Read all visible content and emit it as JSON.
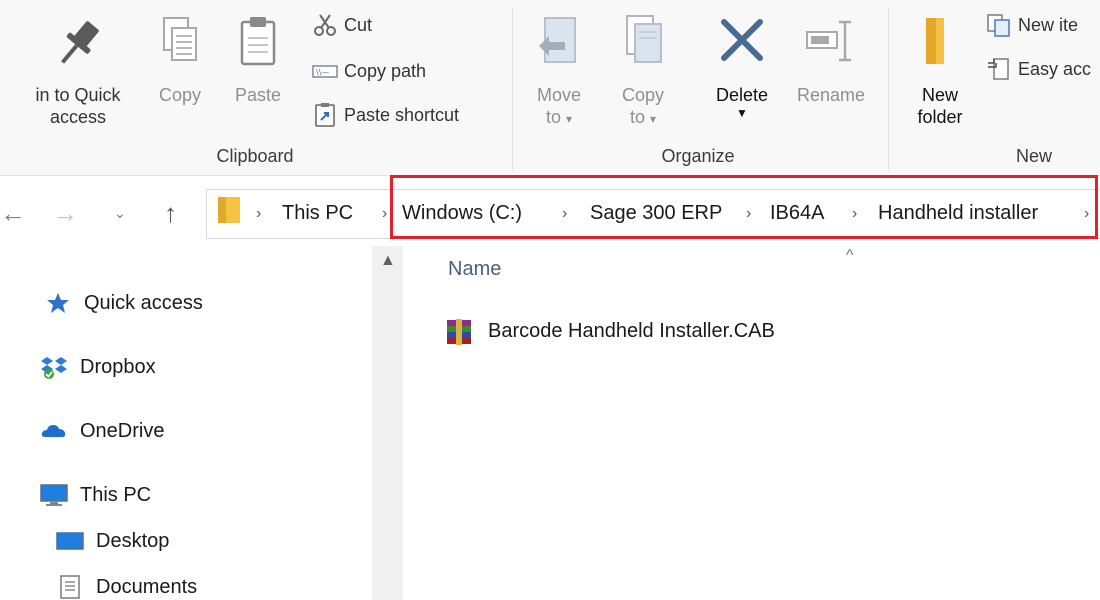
{
  "ribbon": {
    "clipboard": {
      "group_label": "Clipboard",
      "pin_label_line1": "in to Quick",
      "pin_label_line2": "access",
      "copy_label": "Copy",
      "paste_label": "Paste",
      "cut_label": "Cut",
      "copy_path_label": "Copy path",
      "paste_shortcut_label": "Paste shortcut"
    },
    "organize": {
      "group_label": "Organize",
      "move_to_line1": "Move",
      "move_to_line2": "to",
      "copy_to_line1": "Copy",
      "copy_to_line2": "to",
      "delete_label": "Delete",
      "rename_label": "Rename"
    },
    "new": {
      "group_label": "New",
      "new_folder_line1": "New",
      "new_folder_line2": "folder",
      "new_item_label": "New ite",
      "easy_access_label": "Easy acc"
    }
  },
  "address_bar": {
    "crumbs": [
      "This PC",
      "Windows (C:)",
      "Sage 300 ERP",
      "IB64A",
      "Handheld installer"
    ]
  },
  "nav_pane": {
    "items": [
      {
        "label": "Quick access",
        "icon": "star-pin-icon"
      },
      {
        "label": "Dropbox",
        "icon": "dropbox-icon"
      },
      {
        "label": "OneDrive",
        "icon": "onedrive-cloud-icon"
      },
      {
        "label": "This PC",
        "icon": "monitor-icon"
      },
      {
        "label": "Desktop",
        "icon": "desktop-icon"
      },
      {
        "label": "Documents",
        "icon": "documents-icon"
      }
    ]
  },
  "content": {
    "column_name": "Name",
    "files": [
      {
        "name": "Barcode Handheld Installer.CAB",
        "icon": "archive-books-icon"
      }
    ]
  },
  "colors": {
    "highlight": "#e3202d",
    "folder": "#f5c242",
    "accent_blue": "#2b6cc4"
  }
}
